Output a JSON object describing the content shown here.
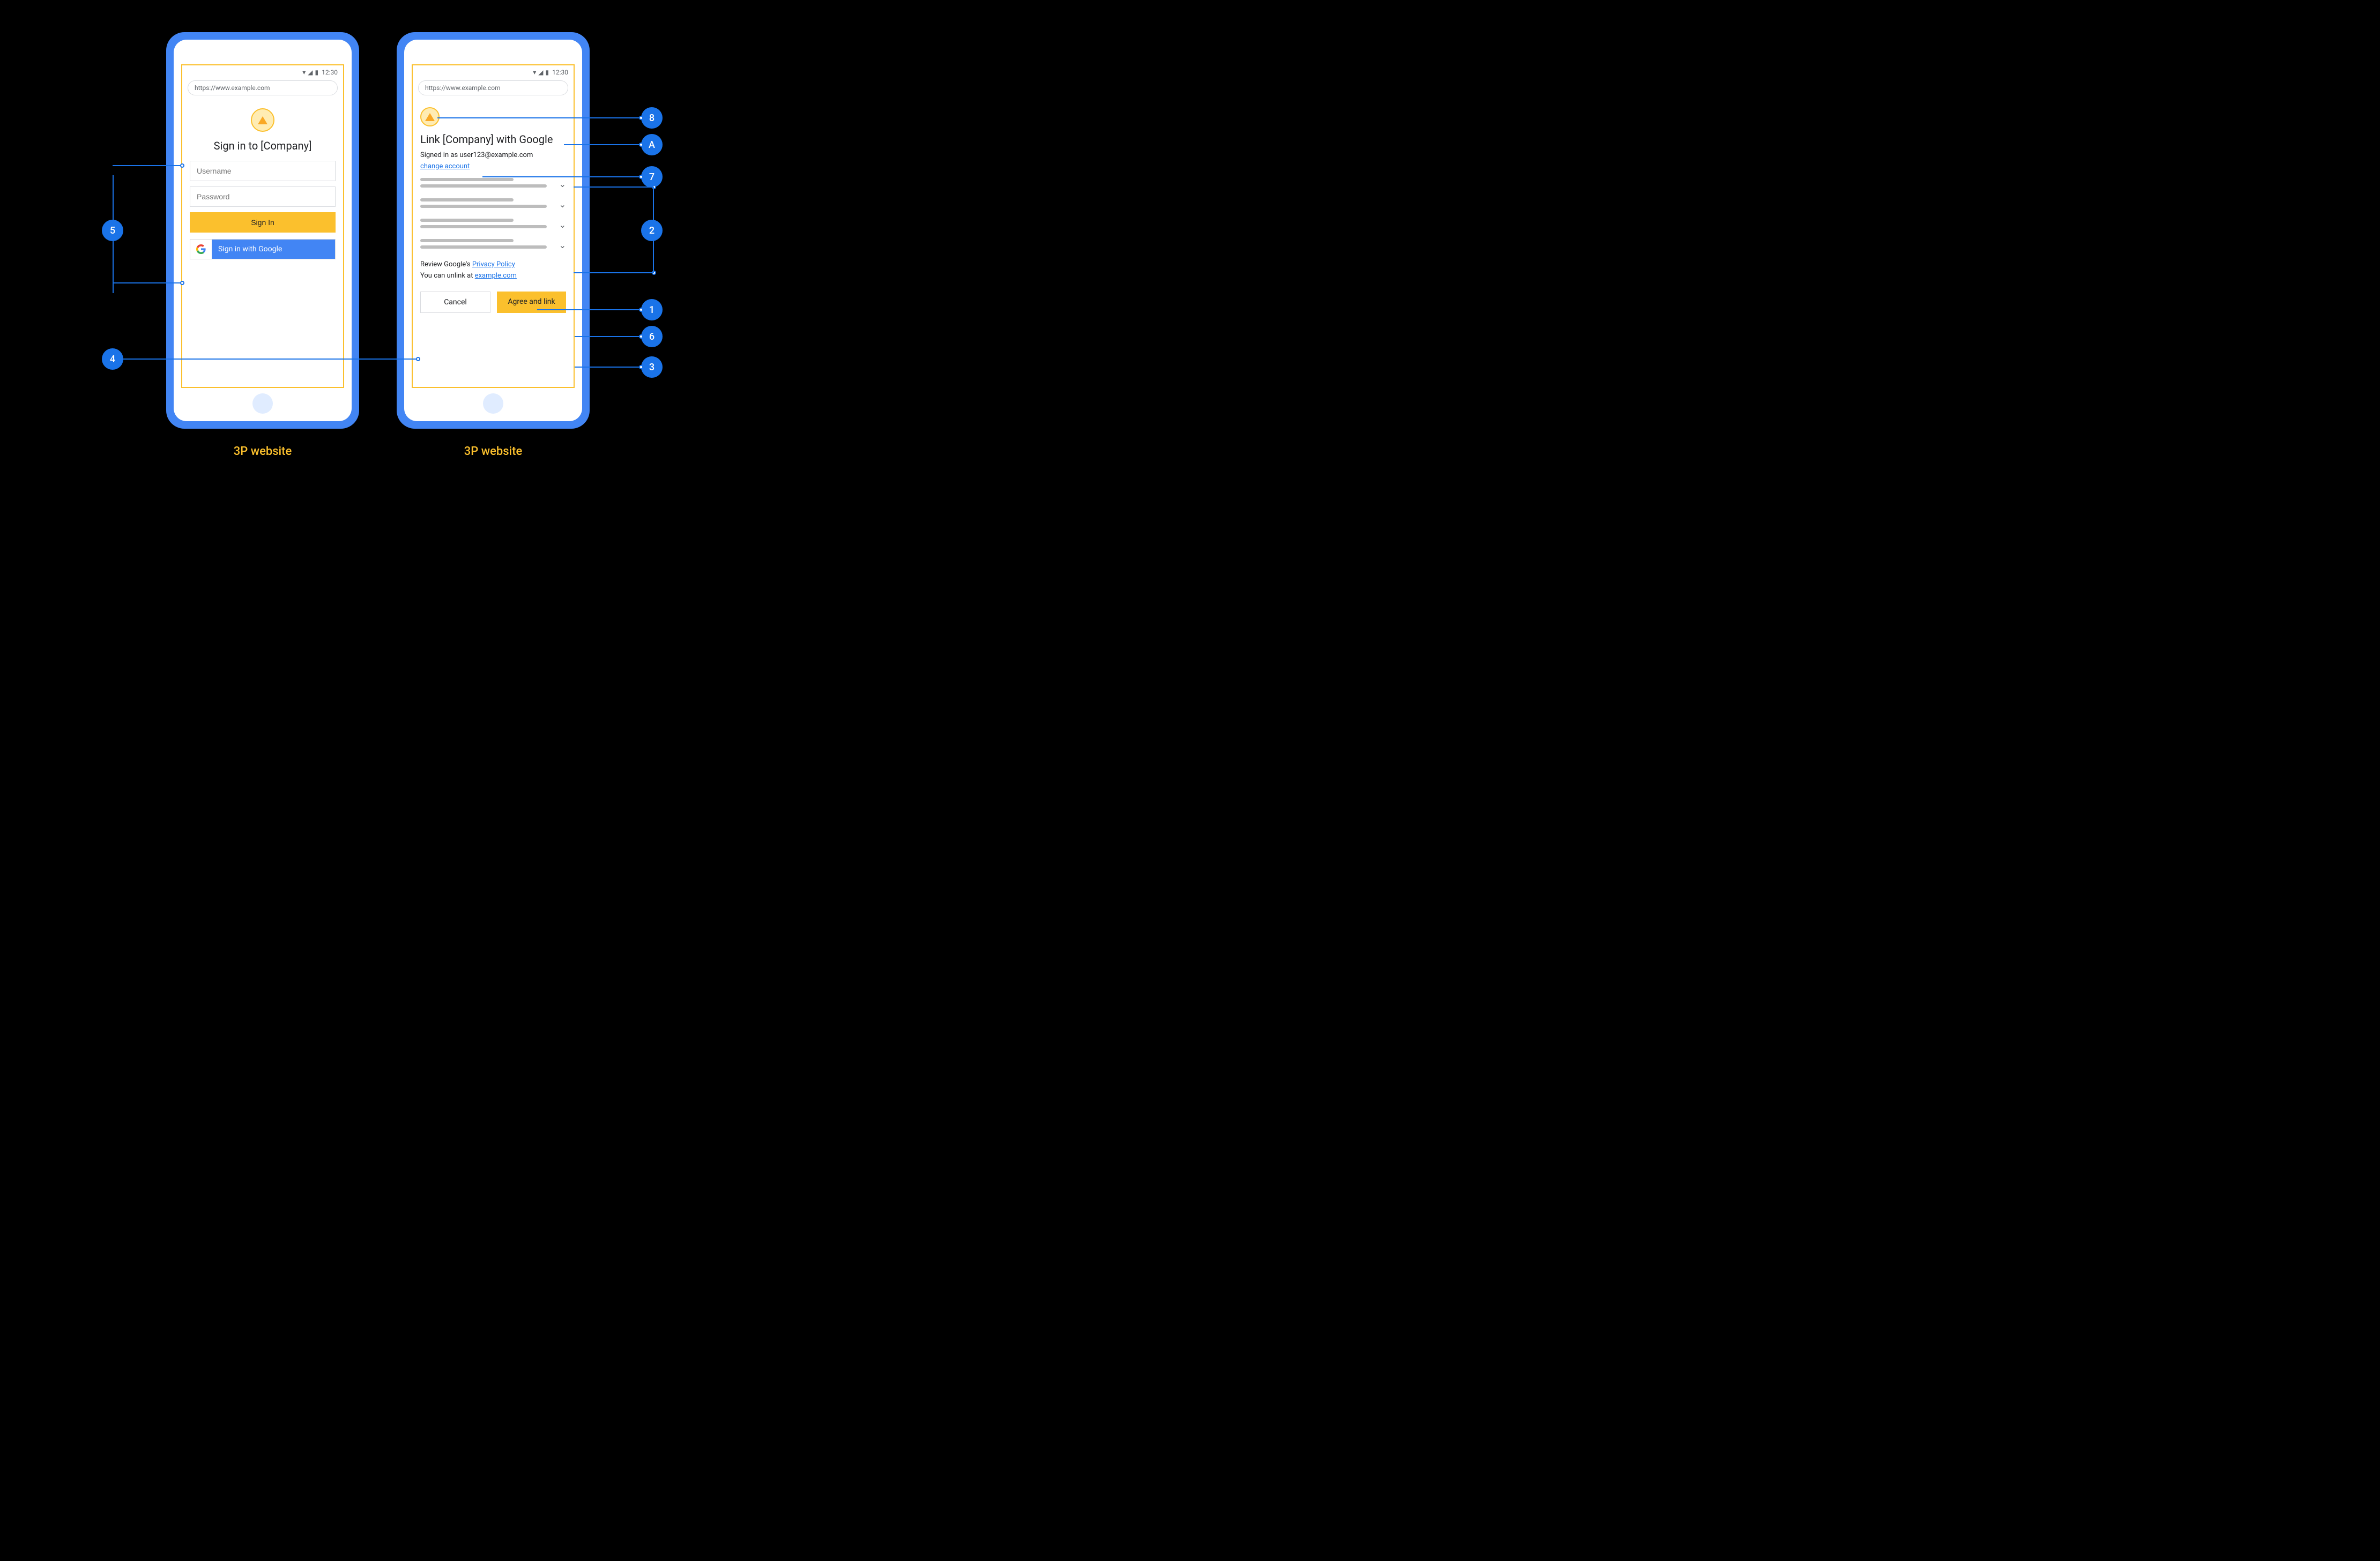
{
  "statusbar": {
    "time": "12:30"
  },
  "url": "https://www.example.com",
  "screen1": {
    "heading": "Sign in to [Company]",
    "username_placeholder": "Username",
    "password_placeholder": "Password",
    "signin_label": "Sign In",
    "google_signin_label": "Sign in with Google"
  },
  "screen2": {
    "heading": "Link [Company] with Google",
    "signed_in_text": "Signed in as user123@example.com",
    "change_account_label": "change account",
    "review_prefix": "Review Google's ",
    "privacy_link": "Privacy Policy",
    "unlink_prefix": "You can unlink at ",
    "unlink_link": "example.com",
    "cancel_label": "Cancel",
    "agree_label": "Agree and link"
  },
  "captions": {
    "left": "3P website",
    "right": "3P website"
  },
  "annotations": {
    "a5": "5",
    "a4": "4",
    "a8": "8",
    "aA": "A",
    "a7": "7",
    "a2": "2",
    "a1": "1",
    "a6": "6",
    "a3": "3"
  }
}
